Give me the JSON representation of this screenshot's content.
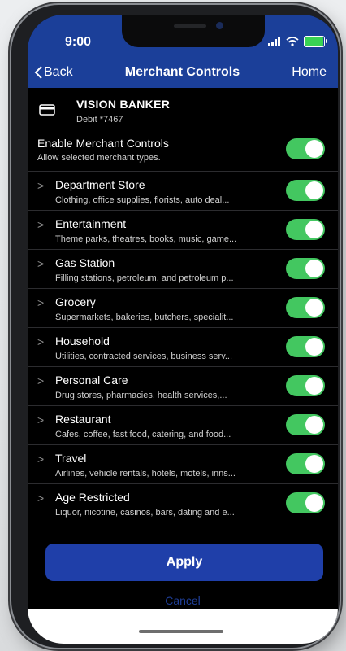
{
  "status": {
    "time": "9:00"
  },
  "nav": {
    "back_label": "Back",
    "title": "Merchant Controls",
    "home_label": "Home"
  },
  "account": {
    "name": "VISION BANKER",
    "number": "Debit *7467",
    "icon": "credit-card-icon"
  },
  "master": {
    "title": "Enable Merchant Controls",
    "subtitle": "Allow selected merchant types.",
    "enabled": true
  },
  "categories": [
    {
      "title": "Department Store",
      "subtitle": "Clothing, office supplies, florists, auto deal...",
      "enabled": true
    },
    {
      "title": "Entertainment",
      "subtitle": "Theme parks, theatres, books, music, game...",
      "enabled": true
    },
    {
      "title": "Gas Station",
      "subtitle": "Filling stations, petroleum, and petroleum p...",
      "enabled": true
    },
    {
      "title": "Grocery",
      "subtitle": "Supermarkets, bakeries, butchers, specialit...",
      "enabled": true
    },
    {
      "title": "Household",
      "subtitle": "Utilities, contracted services, business serv...",
      "enabled": true
    },
    {
      "title": "Personal Care",
      "subtitle": "Drug stores, pharmacies, health services,...",
      "enabled": true
    },
    {
      "title": "Restaurant",
      "subtitle": "Cafes, coffee, fast food, catering, and food...",
      "enabled": true
    },
    {
      "title": "Travel",
      "subtitle": "Airlines, vehicle rentals, hotels, motels, inns...",
      "enabled": true
    },
    {
      "title": "Age Restricted",
      "subtitle": "Liquor, nicotine, casinos, bars, dating and e...",
      "enabled": true
    }
  ],
  "actions": {
    "apply_label": "Apply",
    "cancel_label": "Cancel"
  },
  "colors": {
    "header": "#1b3f99",
    "toggle_on": "#43c760",
    "apply_button": "#1f3fa9"
  }
}
